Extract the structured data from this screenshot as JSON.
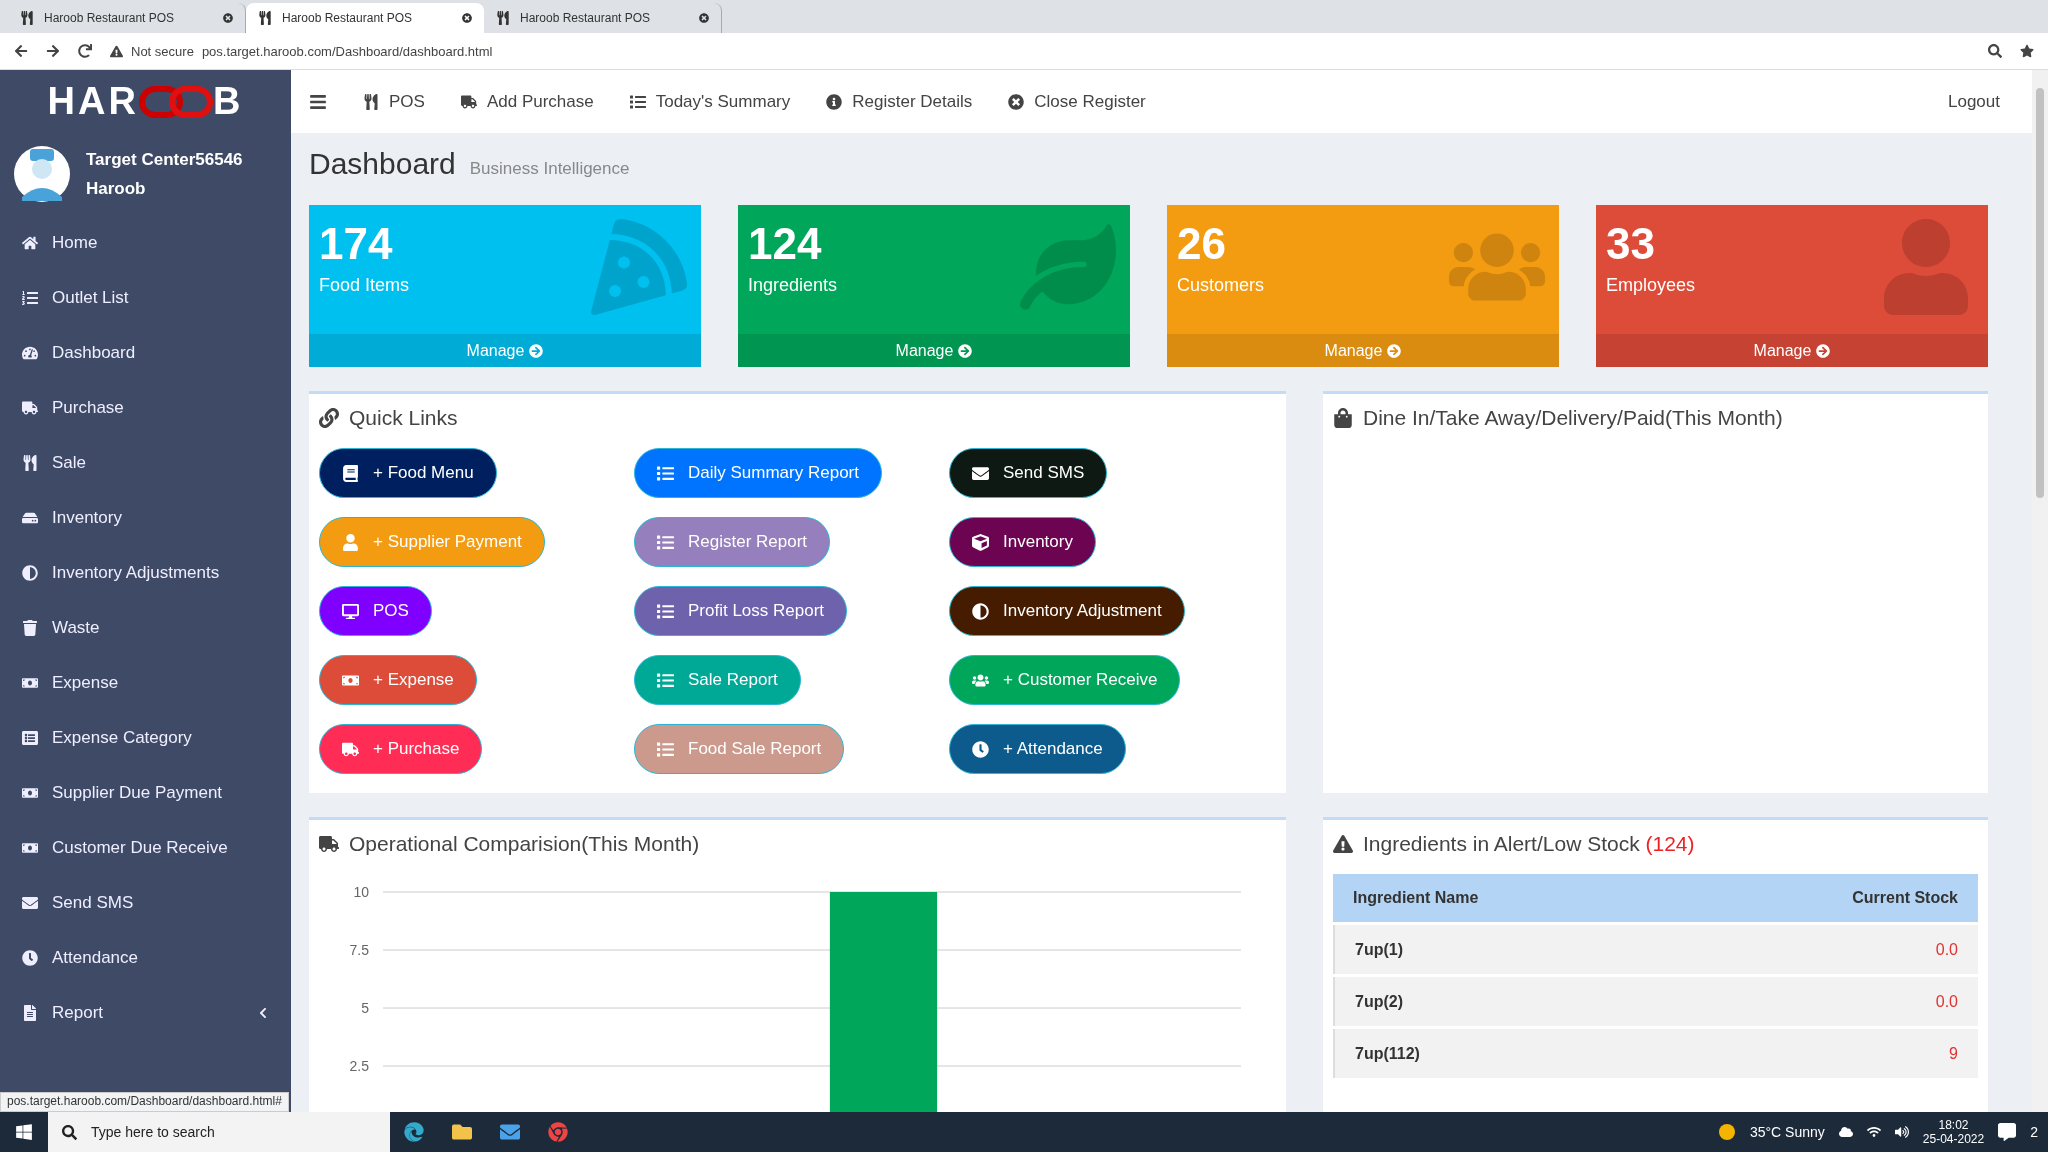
{
  "browser": {
    "tabs": [
      {
        "title": "Haroob Restaurant POS",
        "selected": false
      },
      {
        "title": "Haroob Restaurant POS",
        "selected": true
      },
      {
        "title": "Haroob Restaurant POS",
        "selected": false
      }
    ],
    "security": "Not secure",
    "url": "pos.target.haroob.com/Dashboard/dashboard.html",
    "status_url": "pos.target.haroob.com/Dashboard/dashboard.html#"
  },
  "logo": {
    "left": "HAR",
    "right": "B"
  },
  "user": {
    "line1": "Target Center56546",
    "line2": "Haroob"
  },
  "sidebar": {
    "items": [
      {
        "label": "Home"
      },
      {
        "label": "Outlet List"
      },
      {
        "label": "Dashboard"
      },
      {
        "label": "Purchase"
      },
      {
        "label": "Sale"
      },
      {
        "label": "Inventory"
      },
      {
        "label": "Inventory Adjustments"
      },
      {
        "label": "Waste"
      },
      {
        "label": "Expense"
      },
      {
        "label": "Expense Category"
      },
      {
        "label": "Supplier Due Payment"
      },
      {
        "label": "Customer Due Receive"
      },
      {
        "label": "Send SMS"
      },
      {
        "label": "Attendance"
      },
      {
        "label": "Report",
        "expandable": true
      }
    ]
  },
  "topnav": {
    "items": [
      "POS",
      "Add Purchase",
      "Today's Summary",
      "Register Details",
      "Close Register"
    ],
    "logout": "Logout"
  },
  "page": {
    "title": "Dashboard",
    "subtitle": "Business Intelligence"
  },
  "stats": [
    {
      "value": "174",
      "label": "Food Items",
      "link": "Manage",
      "color": "#00c0ef"
    },
    {
      "value": "124",
      "label": "Ingredients",
      "link": "Manage",
      "color": "#00a65a"
    },
    {
      "value": "26",
      "label": "Customers",
      "link": "Manage",
      "color": "#f39c12"
    },
    {
      "value": "33",
      "label": "Employees",
      "link": "Manage",
      "color": "#dd4b39"
    }
  ],
  "quick_links": {
    "title": "Quick Links",
    "buttons": [
      {
        "label": "+ Food Menu",
        "color": "#001f5f"
      },
      {
        "label": "Daily Summary Report",
        "color": "#0073ff"
      },
      {
        "label": "Send SMS",
        "color": "#0d1912"
      },
      {
        "label": "+ Supplier Payment",
        "color": "#f39c12"
      },
      {
        "label": "Register Report",
        "color": "#967fbd"
      },
      {
        "label": "Inventory",
        "color": "#6c0452"
      },
      {
        "label": "POS",
        "color": "#7f00ff"
      },
      {
        "label": "Profit Loss Report",
        "color": "#6e62ad"
      },
      {
        "label": "Inventory Adjustment",
        "color": "#451c00"
      },
      {
        "label": "+ Expense",
        "color": "#dd4b39"
      },
      {
        "label": "Sale Report",
        "color": "#00a896"
      },
      {
        "label": "+ Customer Receive",
        "color": "#00a65a"
      },
      {
        "label": "+ Purchase",
        "color": "#ff2c55"
      },
      {
        "label": "Food Sale Report",
        "color": "#cc9a8c"
      },
      {
        "label": "+ Attendance",
        "color": "#0d5a8c"
      }
    ]
  },
  "dine_panel": {
    "title": "Dine In/Take Away/Delivery/Paid(This Month)"
  },
  "operational": {
    "title": "Operational Comparision(This Month)",
    "chart_data": {
      "type": "bar",
      "values": [
        0,
        0,
        0,
        10,
        0,
        0
      ],
      "ylim": [
        0,
        10
      ],
      "grid": true,
      "yticks": [
        2.5,
        5,
        7.5,
        10
      ]
    }
  },
  "low_stock": {
    "title": "Ingredients in Alert/Low Stock",
    "count": "(124)",
    "columns": [
      "Ingredient Name",
      "Current Stock"
    ],
    "rows": [
      {
        "name": "7up(1)",
        "stock": "0.0"
      },
      {
        "name": "7up(2)",
        "stock": "0.0"
      },
      {
        "name": "7up(112)",
        "stock": "9"
      }
    ]
  },
  "taskbar": {
    "search_placeholder": "Type here to search",
    "weather": "35°C  Sunny",
    "time": "18:02",
    "date": "25-04-2022",
    "notifications": "2"
  }
}
